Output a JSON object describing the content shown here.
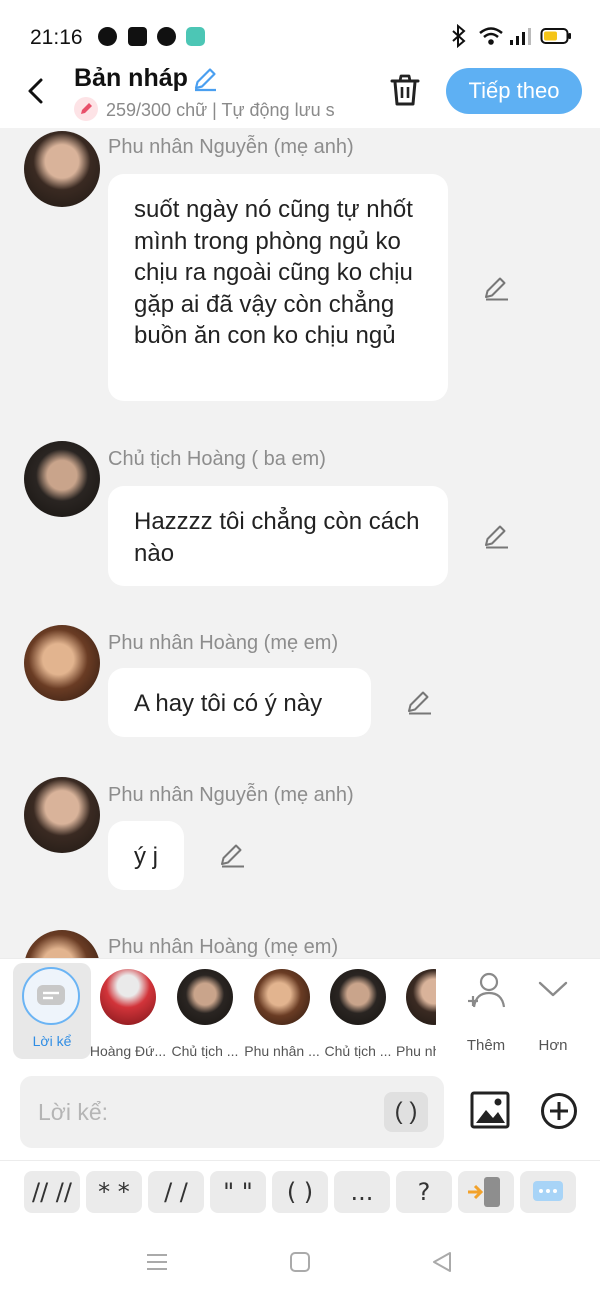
{
  "status_bar": {
    "time": "21:16"
  },
  "header": {
    "title": "Bản nháp",
    "subtitle": "259/300 chữ | Tự động lưu s",
    "next_label": "Tiếp theo"
  },
  "messages": [
    {
      "sender": "Phu nhân Nguyễn (mẹ anh)",
      "text": "suốt ngày nó cũng tự nhốt mình trong phòng ngủ ko chịu ra ngoài cũng ko chịu gặp ai đã vậy còn chẳng buồn ăn con ko chịu ngủ"
    },
    {
      "sender": "Chủ tịch Hoàng ( ba em)",
      "text": "Hazzzz tôi chẳng còn cách nào"
    },
    {
      "sender": "Phu nhân Hoàng (mẹ em)",
      "text": "A hay tôi có ý này"
    },
    {
      "sender": "Phu nhân Nguyễn (mẹ anh)",
      "text": "ý j"
    },
    {
      "sender": "Phu nhân Hoàng (mẹ em)",
      "text": ""
    }
  ],
  "characters": {
    "narrator": "Lời kể",
    "items": [
      "Hoàng Đứ...",
      "Chủ tịch ...",
      "Phu nhân ...",
      "Chủ tịch ...",
      "Phu nh"
    ],
    "add_label": "Thêm",
    "more_label": "Hơn"
  },
  "input": {
    "placeholder": "Lời kể:",
    "paren_button": "( )"
  },
  "symbols": [
    "// //",
    "* *",
    "/ /",
    "\" \"",
    "( )",
    "...",
    "?"
  ],
  "colors": {
    "accent": "#5eb0f3",
    "background": "#f2f2f2",
    "bubble": "#ffffff"
  }
}
